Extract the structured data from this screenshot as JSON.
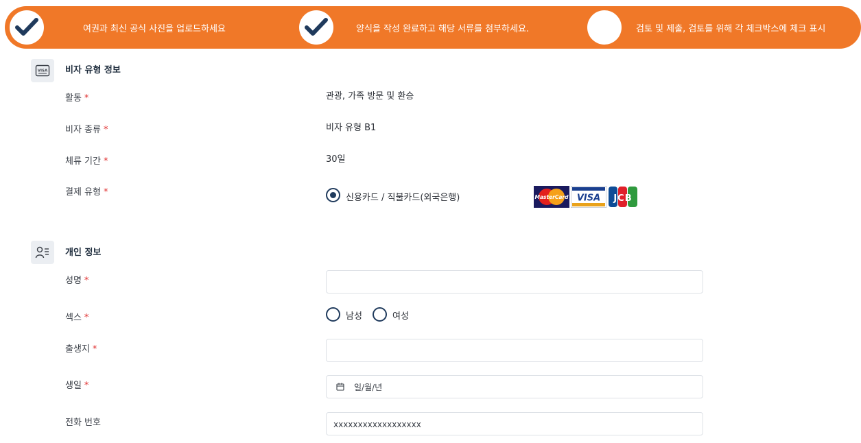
{
  "steps": [
    {
      "label": "여권과 최신 공식 사진을 업로드하세요",
      "done": true
    },
    {
      "label": "양식을 작성 완료하고 해당 서류를 첨부하세요.",
      "done": true
    },
    {
      "label": "검토 및 제출, 검토를 위해 각 체크박스에 체크 표시",
      "done": false
    }
  ],
  "visa_section": {
    "title": "비자 유형 정보",
    "icon": "visa-card-icon",
    "rows": {
      "activity": {
        "label": "활동",
        "value": "관광, 가족 방문 및 환승"
      },
      "visa_type": {
        "label": "비자 종류",
        "value": "비자 유형 B1"
      },
      "stay": {
        "label": "체류 기간",
        "value": "30일"
      },
      "payment": {
        "label": "결제 유형",
        "option": "신용카드 / 직불카드(외국은행)",
        "selected": true
      }
    },
    "cards": [
      "MasterCard",
      "VISA",
      "JCB"
    ]
  },
  "personal_section": {
    "title": "개인 정보",
    "icon": "person-list-icon",
    "name": {
      "label": "성명",
      "value": ""
    },
    "sex": {
      "label": "섹스",
      "options": [
        "남성",
        "여성"
      ]
    },
    "birthplace": {
      "label": "출생지",
      "value": ""
    },
    "birthday": {
      "label": "생일",
      "placeholder": "일/월/년"
    },
    "phone": {
      "label": "전화 번호",
      "placeholder": "xxxxxxxxxxxxxxxxxx"
    }
  },
  "required_mark": "*",
  "colors": {
    "accent": "#f07828",
    "check": "#1f3a5c",
    "required": "#e03131"
  }
}
